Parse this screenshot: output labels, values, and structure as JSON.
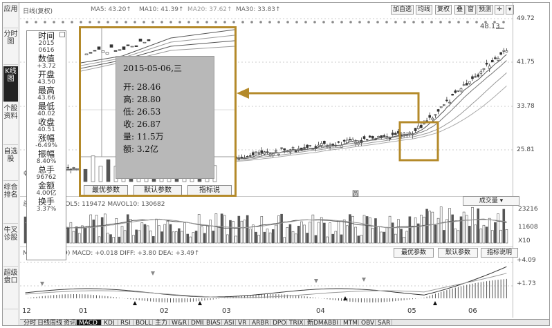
{
  "leftnav": [
    {
      "label": "应用"
    },
    {
      "label": "分时图"
    },
    {
      "label": "K线图",
      "active": true
    },
    {
      "label": "个股资料"
    },
    {
      "label": "自选股"
    },
    {
      "label": "综合排名"
    },
    {
      "label": "牛叉诊股"
    },
    {
      "label": "超级盘口"
    }
  ],
  "header": {
    "title": "日线(复权)",
    "ma5": "MA5: 43.20↑",
    "ma10": "MA10: 41.39↑",
    "ma20": "MA20: 37.62↑",
    "ma30": "MA30: 33.83↑",
    "buttons": [
      "加自选",
      "均线",
      "复权",
      "叠",
      "窗",
      "预测"
    ]
  },
  "price_axis": [
    "49.72",
    "41.75",
    "33.78",
    "25.81"
  ],
  "peak_label": "48.13",
  "time_axis": [
    "12",
    "01",
    "02",
    "03",
    "04",
    "05",
    "06"
  ],
  "volume": {
    "legend": "总手: 96762  VOL5: 119472  MAVOL10: 130682",
    "selector": "成交量",
    "axis": [
      "23216",
      "11608",
      "X10"
    ],
    "marker": "圆"
  },
  "macd": {
    "legend": "MACD(12,26,9)  MACD: +0.018  DIFF: +3.80  DEA: +3.49↑",
    "buttons": [
      "最优参数",
      "默认参数",
      "指标说明"
    ],
    "axis": [
      "+4.09",
      "+1.73"
    ]
  },
  "infobox": [
    {
      "k": "时间",
      "v": "2015\n0616"
    },
    {
      "k": "数值",
      "v": "+3.72"
    },
    {
      "k": "开盘",
      "v": "43.50"
    },
    {
      "k": "最高",
      "v": "43.66"
    },
    {
      "k": "最低",
      "v": "40.02"
    },
    {
      "k": "收盘",
      "v": "40.51"
    },
    {
      "k": "涨幅",
      "v": "-6.49%"
    },
    {
      "k": "振幅",
      "v": "8.40%"
    },
    {
      "k": "总手",
      "v": "96762"
    },
    {
      "k": "金额",
      "v": "4.00亿"
    },
    {
      "k": "换手",
      "v": "3.37%"
    }
  ],
  "tooltip": {
    "date": "2015-05-06,三",
    "rows": [
      "开: 28.46",
      "高: 28.80",
      "低: 26.53",
      "收: 26.87",
      "量: 11.5万",
      "额: 3.2亿"
    ]
  },
  "zoom_buttons": [
    "最优参数",
    "默认参数",
    "指标说"
  ],
  "tabs": [
    "分时",
    "日线周线",
    "资讯",
    "MACD",
    "KDJ",
    "RSI",
    "BOLL",
    "主力",
    "W&R",
    "DMI",
    "BIAS",
    "ASI",
    "VR",
    "ARBR",
    "DPO",
    "TRIX",
    "新DMA",
    "BBI",
    "MTM",
    "OBV",
    "SAR"
  ],
  "active_tab": "MACD",
  "colors": {
    "highlight": "#b48a2a",
    "tooltip_bg": "#b8b8b8"
  }
}
